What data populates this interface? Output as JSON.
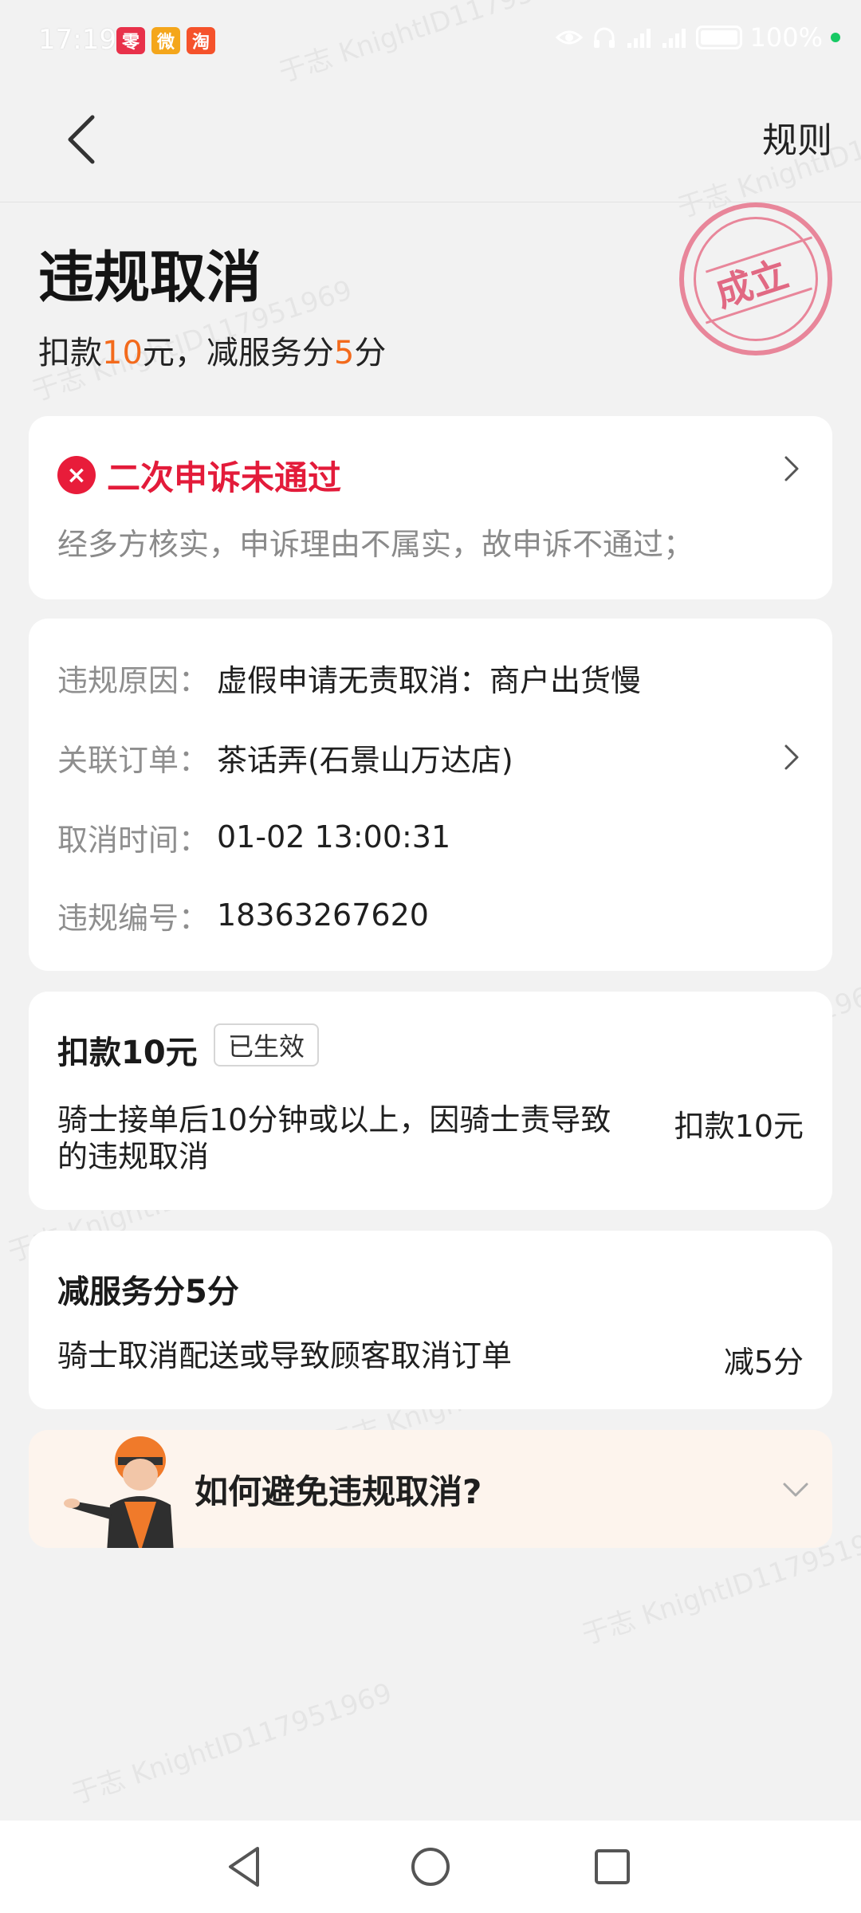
{
  "status_bar": {
    "time": "17:19",
    "battery": "100%",
    "apps": [
      {
        "name": "app-icon-1",
        "glyph": "零",
        "color": "#e8314a"
      },
      {
        "name": "weibo-icon",
        "glyph": "微",
        "color": "#f4a61b"
      },
      {
        "name": "taobao-icon",
        "glyph": "淘",
        "color": "#f5522b"
      }
    ]
  },
  "nav": {
    "rules_label": "规则"
  },
  "header": {
    "title": "违规取消",
    "sub_prefix": "扣款",
    "sub_amount": "10",
    "sub_mid": "元，减服务分",
    "sub_points": "5",
    "sub_suffix": "分",
    "stamp_text": "成立"
  },
  "appeal": {
    "icon": "×",
    "title": "二次申诉未通过",
    "description": "经多方核实，申诉理由不属实，故申诉不通过；"
  },
  "details": [
    {
      "key": "违规原因：",
      "value": "虚假申请无责取消：商户出货慢"
    },
    {
      "key": "关联订单：",
      "value": "茶话弄(石景山万达店)"
    },
    {
      "key": "取消时间：",
      "value": "01-02 13:00:31"
    },
    {
      "key": "违规编号：",
      "value": "18363267620"
    }
  ],
  "deduction": {
    "title": "扣款10元",
    "badge": "已生效",
    "rule": "骑士接单后10分钟或以上，因骑士责导致的违规取消",
    "amount": "扣款10元"
  },
  "score": {
    "title": "减服务分5分",
    "rule": "骑士取消配送或导致顾客取消订单",
    "amount": "减5分"
  },
  "tip": {
    "title": "如何避免违规取消?"
  },
  "watermark": "于志 KnightID117951969"
}
